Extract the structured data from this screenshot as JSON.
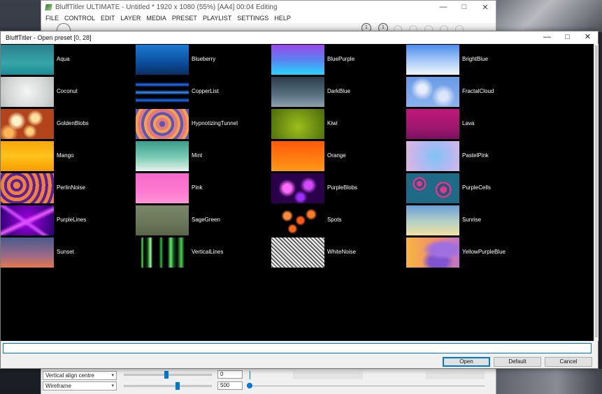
{
  "main_window": {
    "title": "BluffTitler ULTIMATE - Untitled * 1920 x 1080 (55%) [AA4] 00:04 Editing",
    "menu": [
      "FILE",
      "CONTROL",
      "EDIT",
      "LAYER",
      "MEDIA",
      "PRESET",
      "PLAYLIST",
      "SETTINGS",
      "HELP"
    ],
    "badges": [
      "1",
      "1"
    ],
    "bottom": {
      "select_1": "Vertical align centre",
      "select_2": "Wireframe",
      "value_1": "0",
      "value_2": "500"
    }
  },
  "dialog": {
    "title": "BluffTitler - Open preset [0, 28]",
    "search_value": "",
    "buttons": {
      "open": "Open",
      "default": "Default",
      "cancel": "Cancel"
    }
  },
  "presets": [
    "Aqua",
    "Blueberry",
    "BluePurple",
    "BrightBlue",
    "Coconut",
    "CopperList",
    "DarkBlue",
    "FractalCloud",
    "GoldenBlobs",
    "HypnotizingTunnel",
    "Kiwi",
    "Lava",
    "Mango",
    "Mint",
    "Orange",
    "PastelPink",
    "PerlinNoise",
    "Pink",
    "PurpleBlobs",
    "PurpleCells",
    "PurpleLines",
    "SageGreen",
    "Spots",
    "Sunrise",
    "Sunset",
    "VerticalLines",
    "WhiteNoise",
    "YellowPurpleBlue"
  ],
  "icons": {
    "minimize": "minimize-icon",
    "maximize": "maximize-icon",
    "close": "close-icon"
  }
}
